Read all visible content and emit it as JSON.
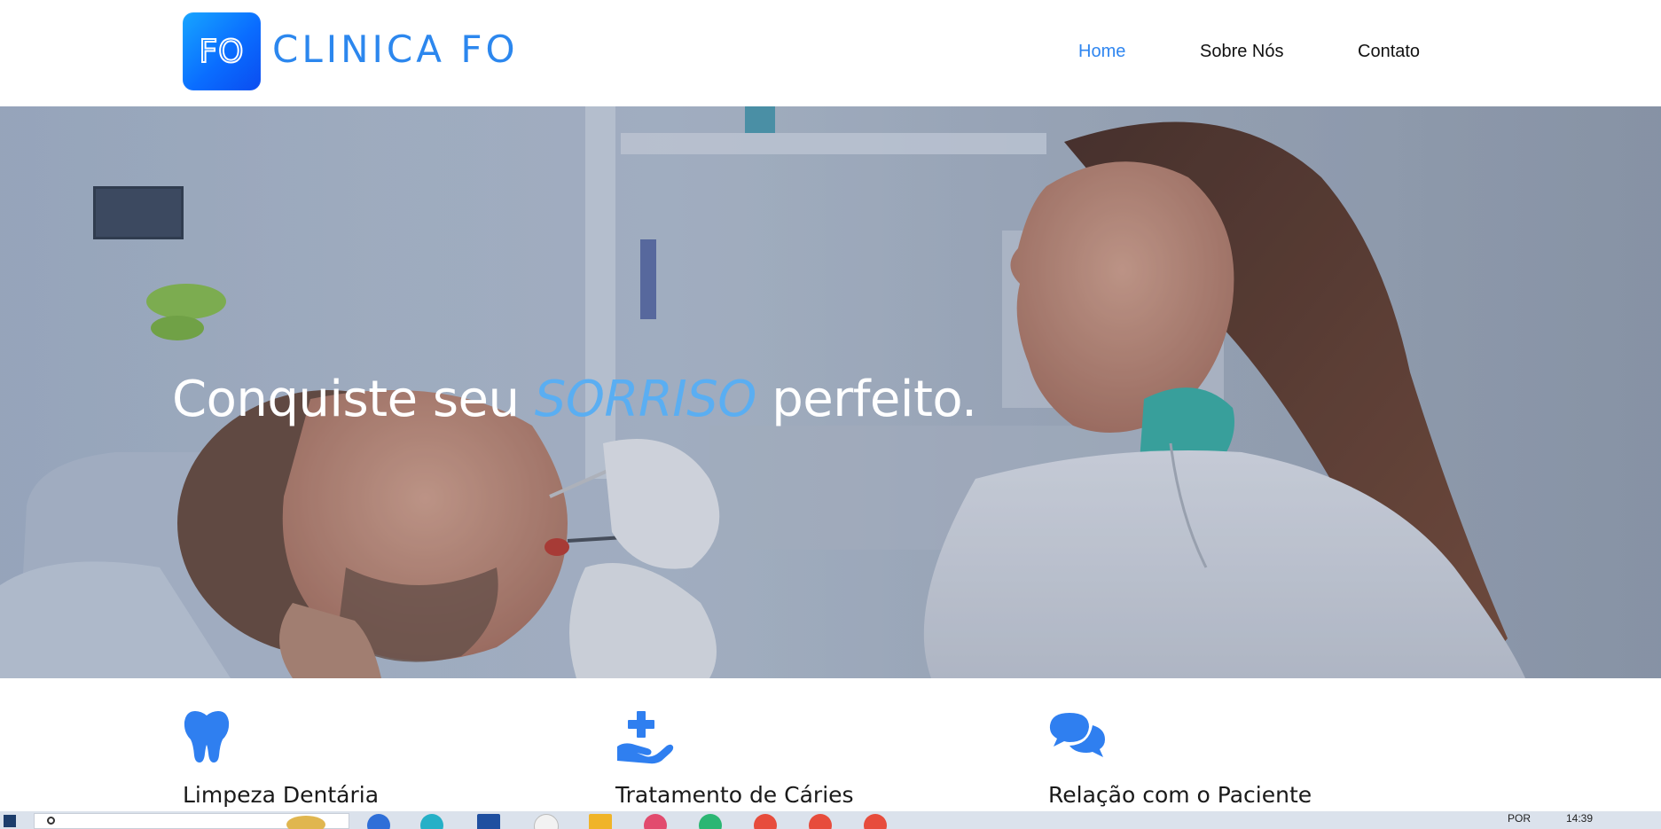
{
  "header": {
    "logo_text": "FO",
    "brand": "CLINICA FO",
    "nav": [
      {
        "label": "Home",
        "active": true
      },
      {
        "label": "Sobre Nós",
        "active": false
      },
      {
        "label": "Contato",
        "active": false
      }
    ]
  },
  "hero": {
    "title_before": "Conquiste seu",
    "title_accent": "SORRISO",
    "title_after": "perfeito."
  },
  "features": [
    {
      "icon": "tooth-icon",
      "title": "Limpeza Dentária"
    },
    {
      "icon": "hand-holding-medical-icon",
      "title": "Tratamento de Cáries"
    },
    {
      "icon": "comments-icon",
      "title": "Relação com o Paciente"
    }
  ],
  "taskbar": {
    "language": "POR",
    "time": "14:39"
  },
  "colors": {
    "brand": "#2c87ee",
    "nav_active": "#2f86f0",
    "accent": "#5aaef2",
    "icon": "#2f7ff0"
  }
}
